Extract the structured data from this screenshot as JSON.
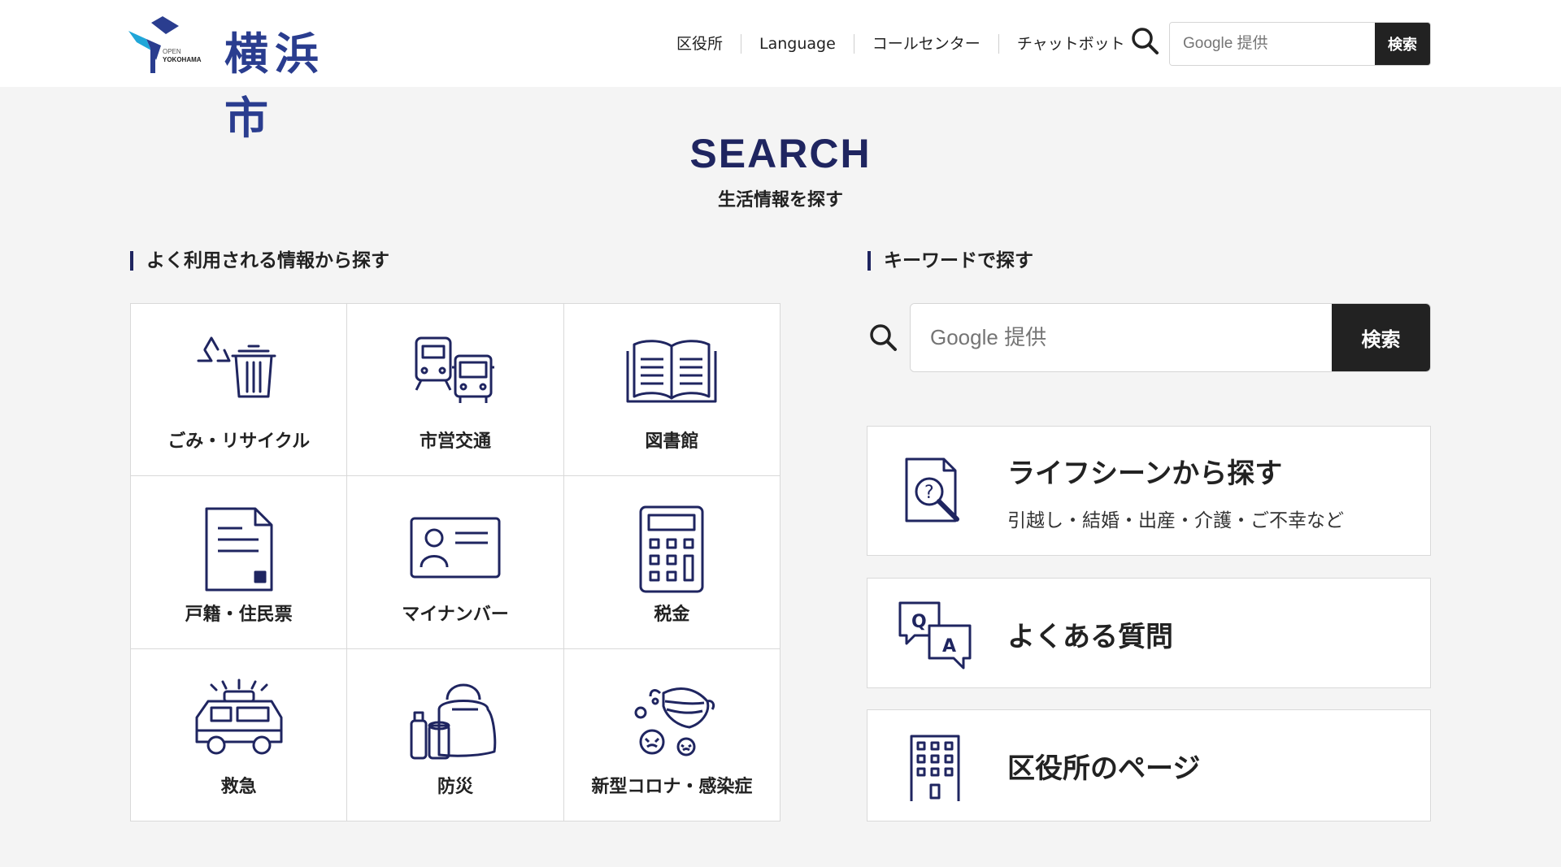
{
  "header": {
    "logo_text": "横浜市",
    "logo_small": "OPEN YOKOHAMA",
    "nav": [
      "区役所",
      "Language",
      "コールセンター",
      "チャットボット"
    ],
    "search": {
      "placeholder": "Google 提供",
      "button": "検索"
    }
  },
  "hero": {
    "title": "SEARCH",
    "subtitle": "生活情報を探す"
  },
  "frequent": {
    "heading": "よく利用される情報から探す",
    "items": [
      {
        "label": "ごみ・リサイクル",
        "icon": "trash-recycle-icon"
      },
      {
        "label": "市営交通",
        "icon": "train-bus-icon"
      },
      {
        "label": "図書館",
        "icon": "open-book-icon"
      },
      {
        "label": "戸籍・住民票",
        "icon": "document-icon"
      },
      {
        "label": "マイナンバー",
        "icon": "id-card-icon"
      },
      {
        "label": "税金",
        "icon": "calculator-icon"
      },
      {
        "label": "救急",
        "icon": "ambulance-icon"
      },
      {
        "label": "防災",
        "icon": "emergency-kit-icon"
      },
      {
        "label": "新型コロナ・感染症",
        "icon": "mask-virus-icon"
      }
    ]
  },
  "keyword": {
    "heading": "キーワードで探す",
    "search": {
      "placeholder": "Google 提供",
      "button": "検索"
    }
  },
  "links": [
    {
      "title": "ライフシーンから探す",
      "subtitle": "引越し・結婚・出産・介護・ご不幸など",
      "icon": "document-search-icon"
    },
    {
      "title": "よくある質問",
      "icon": "qa-bubbles-icon"
    },
    {
      "title": "区役所のページ",
      "icon": "building-icon"
    }
  ],
  "colors": {
    "accent": "#1f2560",
    "logo_blue": "#2a3d8f",
    "button": "#222222",
    "background": "#f4f4f4"
  }
}
